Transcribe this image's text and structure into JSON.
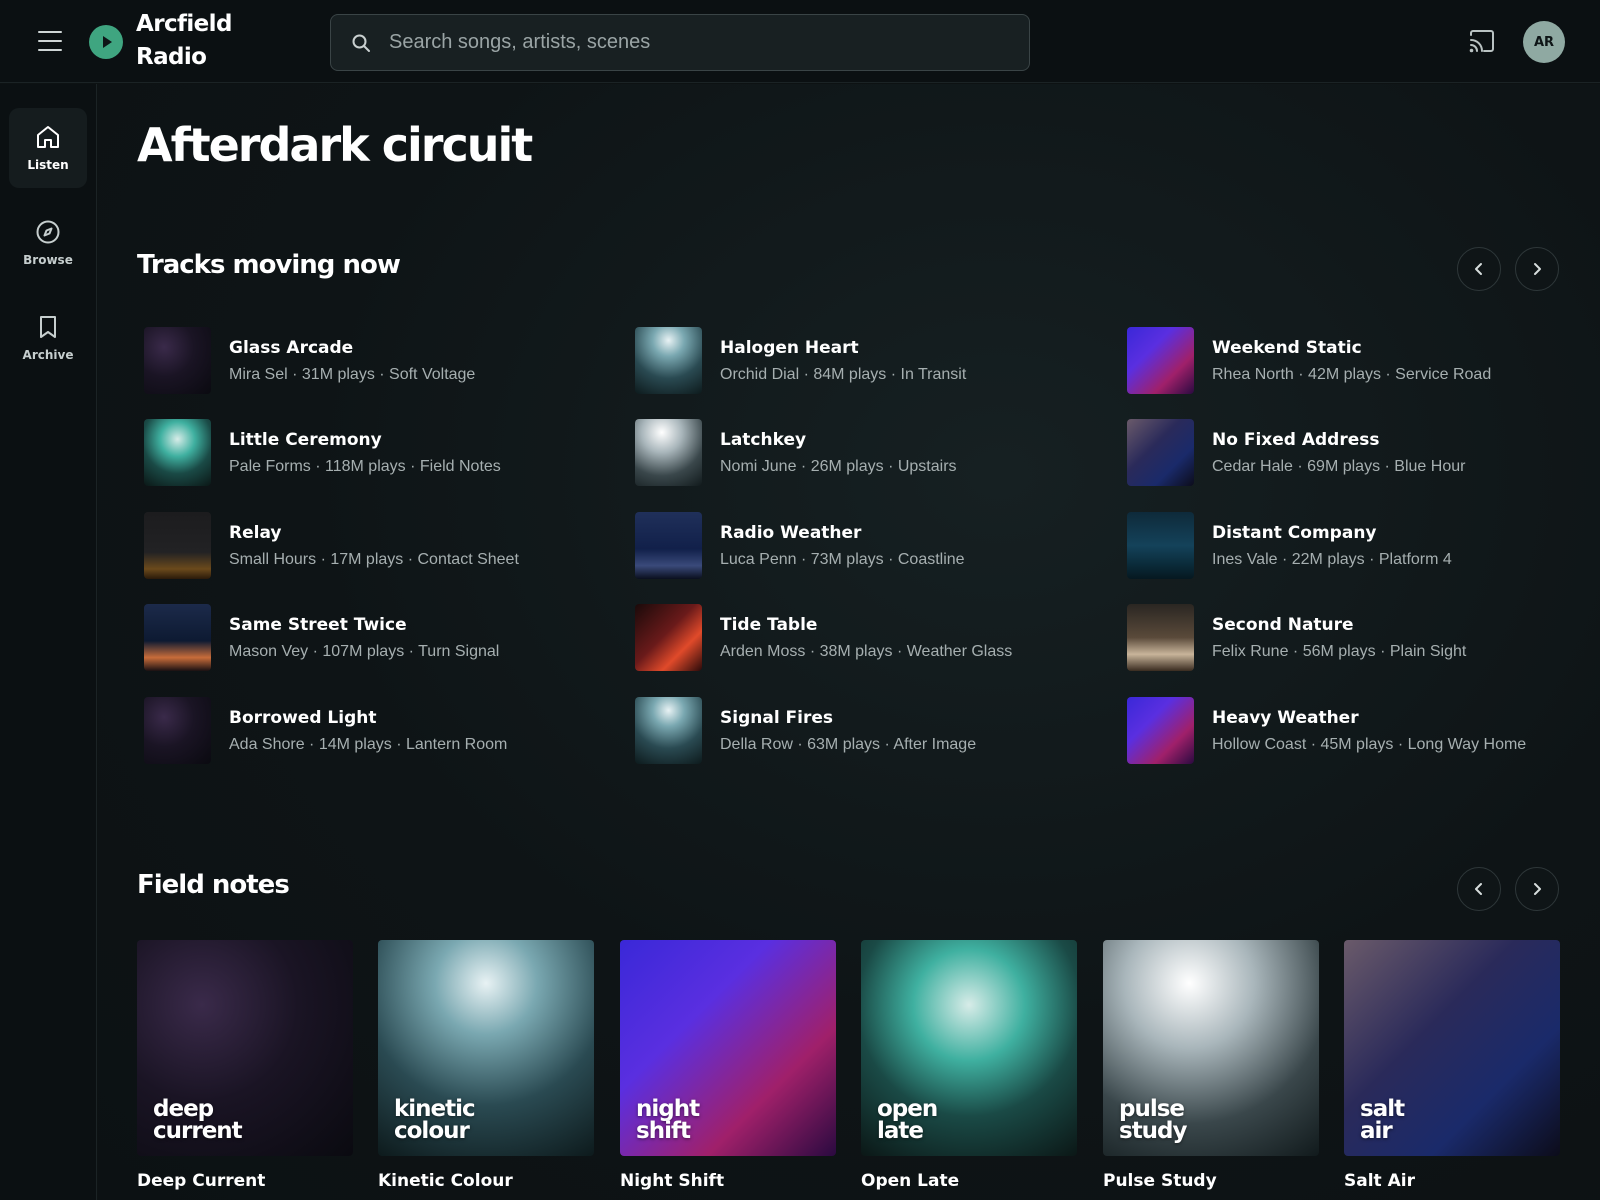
{
  "app": {
    "brand_line1": "Arcfield",
    "brand_line2": "Radio",
    "accent_color": "#3fa580"
  },
  "header": {
    "search_placeholder": "Search songs, artists, scenes",
    "search_value": "",
    "avatar_initials": "AR",
    "menu_icon": "menu-icon",
    "cast_icon": "cast-icon"
  },
  "sidebar": {
    "items": [
      {
        "label": "Listen",
        "icon": "home-icon",
        "active": true
      },
      {
        "label": "Browse",
        "icon": "compass-icon",
        "active": false
      },
      {
        "label": "Archive",
        "icon": "bookmark-icon",
        "active": false
      }
    ]
  },
  "main": {
    "page_title": "Afterdark circuit",
    "tracks_section": {
      "title": "Tracks moving now",
      "tracks": [
        {
          "title": "Glass Arcade",
          "meta": "Mira Sel · 31M plays · Soft Voltage"
        },
        {
          "title": "Halogen Heart",
          "meta": "Orchid Dial · 84M plays · In Transit"
        },
        {
          "title": "Weekend Static",
          "meta": "Rhea North · 42M plays · Service Road"
        },
        {
          "title": "Little Ceremony",
          "meta": "Pale Forms · 118M plays · Field Notes"
        },
        {
          "title": "Latchkey",
          "meta": "Nomi June · 26M plays · Upstairs"
        },
        {
          "title": "No Fixed Address",
          "meta": "Cedar Hale · 69M plays · Blue Hour"
        },
        {
          "title": "Relay",
          "meta": "Small Hours · 17M plays · Contact Sheet"
        },
        {
          "title": "Radio Weather",
          "meta": "Luca Penn · 73M plays · Coastline"
        },
        {
          "title": "Distant Company",
          "meta": "Ines Vale · 22M plays · Platform 4"
        },
        {
          "title": "Same Street Twice",
          "meta": "Mason Vey · 107M plays · Turn Signal"
        },
        {
          "title": "Tide Table",
          "meta": "Arden Moss · 38M plays · Weather Glass"
        },
        {
          "title": "Second Nature",
          "meta": "Felix Rune · 56M plays · Plain Sight"
        },
        {
          "title": "Borrowed Light",
          "meta": "Ada Shore · 14M plays · Lantern Room"
        },
        {
          "title": "Signal Fires",
          "meta": "Della Row · 63M plays · After Image"
        },
        {
          "title": "Heavy Weather",
          "meta": "Hollow Coast · 45M plays · Long Way Home"
        }
      ]
    },
    "field_notes": {
      "title": "Field notes",
      "cards": [
        {
          "overlay_line1": "deep",
          "overlay_line2": "current",
          "name": "Deep Current"
        },
        {
          "overlay_line1": "kinetic",
          "overlay_line2": "colour",
          "name": "Kinetic Colour"
        },
        {
          "overlay_line1": "night",
          "overlay_line2": "shift",
          "name": "Night Shift"
        },
        {
          "overlay_line1": "open",
          "overlay_line2": "late",
          "name": "Open Late"
        },
        {
          "overlay_line1": "pulse",
          "overlay_line2": "study",
          "name": "Pulse Study"
        },
        {
          "overlay_line1": "salt",
          "overlay_line2": "air",
          "name": "Salt Air"
        }
      ]
    }
  }
}
